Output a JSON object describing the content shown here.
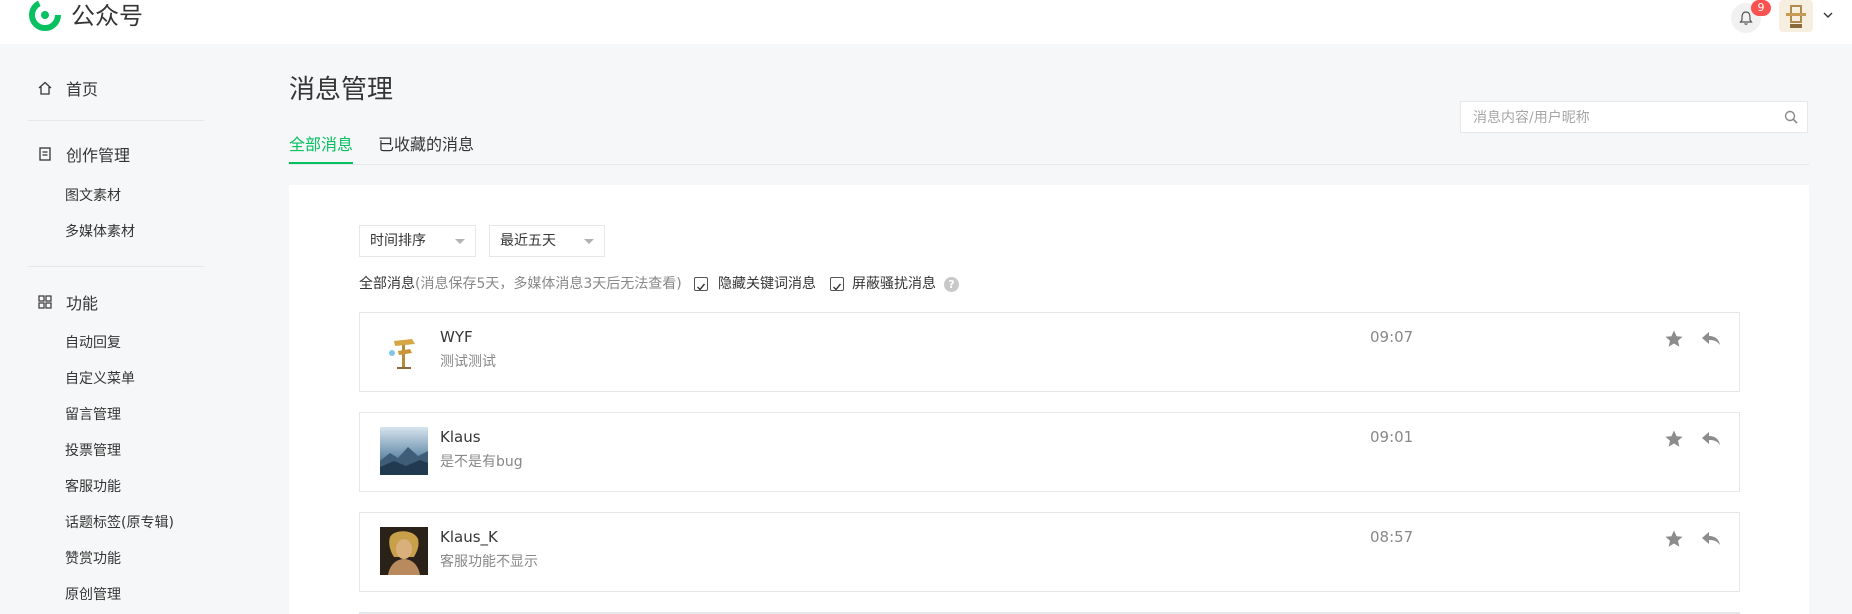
{
  "header": {
    "brand": "公众号",
    "notification_count": "9"
  },
  "sidebar": {
    "home": "首页",
    "creation": {
      "title": "创作管理",
      "items": [
        "图文素材",
        "多媒体素材"
      ]
    },
    "features": {
      "title": "功能",
      "items": [
        "自动回复",
        "自定义菜单",
        "留言管理",
        "投票管理",
        "客服功能",
        "话题标签(原专辑)",
        "赞赏功能",
        "原创管理"
      ]
    }
  },
  "main": {
    "title": "消息管理",
    "tabs": [
      {
        "label": "全部消息",
        "active": true
      },
      {
        "label": "已收藏的消息",
        "active": false
      }
    ],
    "search_placeholder": "消息内容/用户昵称",
    "sort_select": "时间排序",
    "range_select": "最近五天",
    "filter_title": "全部消息",
    "filter_note": "(消息保存5天，多媒体消息3天后无法查看)",
    "hide_keywords_label": "隐藏关键词消息",
    "hide_keywords_checked": true,
    "block_spam_label": "屏蔽骚扰消息",
    "block_spam_checked": true,
    "help_glyph": "?"
  },
  "messages": [
    {
      "name": "WYF",
      "text": "测试测试",
      "time": "09:07",
      "avatar": "signpost-avatar"
    },
    {
      "name": "Klaus",
      "text": "是不是有bug",
      "time": "09:01",
      "avatar": "landscape-avatar"
    },
    {
      "name": "Klaus_K",
      "text": "客服功能不显示",
      "time": "08:57",
      "avatar": "portrait-avatar"
    }
  ],
  "colors": {
    "accent": "#07c160",
    "badge": "#fa5151",
    "background": "#f6f7f8"
  }
}
